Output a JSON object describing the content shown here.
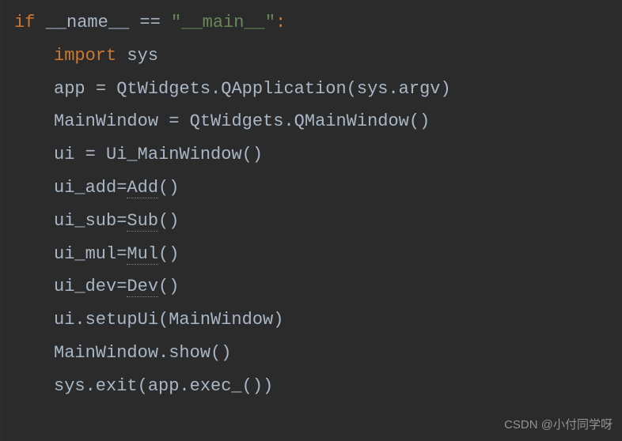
{
  "code": {
    "line1": {
      "kw": "if",
      "sp1": " ",
      "name": "__name__",
      "sp2": " ",
      "eq": "==",
      "sp3": " ",
      "str": "\"__main__\"",
      "colon": ":"
    },
    "line2": {
      "kw": "import",
      "sp": " ",
      "mod": "sys"
    },
    "line3": {
      "lhs": "app ",
      "eq": "= ",
      "rhs": "QtWidgets.QApplication(sys.argv)"
    },
    "line4": {
      "lhs": "MainWindow ",
      "eq": "= ",
      "rhs": "QtWidgets.QMainWindow()"
    },
    "line5": {
      "lhs": "ui ",
      "eq": "= ",
      "rhs": "Ui_MainWindow()"
    },
    "line6": {
      "lhs": "ui_add",
      "eq": "=",
      "call": "Add",
      "paren": "()"
    },
    "line7": {
      "lhs": "ui_sub",
      "eq": "=",
      "call": "Sub",
      "paren": "()"
    },
    "line8": {
      "lhs": "ui_mul",
      "eq": "=",
      "call": "Mul",
      "paren": "()"
    },
    "line9": {
      "lhs": "ui_dev",
      "eq": "=",
      "call": "Dev",
      "paren": "()"
    },
    "line10": {
      "txt": "ui.setupUi(MainWindow)"
    },
    "line11": {
      "txt": "MainWindow.show()"
    },
    "line12": {
      "txt": "sys.exit(app.exec_())"
    }
  },
  "watermark": "CSDN @小付同学呀"
}
